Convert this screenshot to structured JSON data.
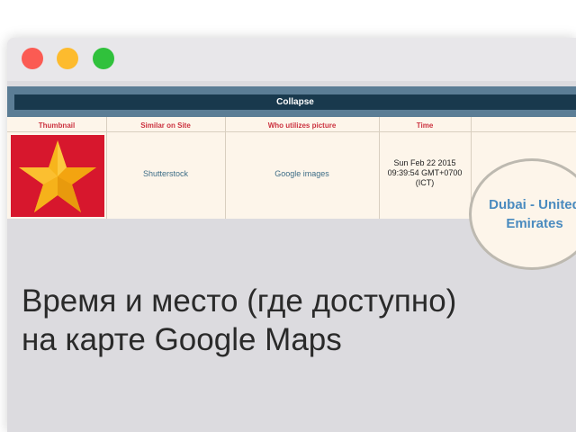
{
  "table": {
    "collapse_label": "Collapse",
    "headers": [
      "Thumbnail",
      "Similar on Site",
      "Who utilizes picture",
      "Time"
    ],
    "row": {
      "similar": "Shutterstock",
      "who": "Google images",
      "time_line1": "Sun Feb 22 2015",
      "time_line2": "09:39:54 GMT+0700",
      "time_line3": "(ICT)"
    }
  },
  "magnifier": {
    "line1": "Dubai - United",
    "line2": "Emirates"
  },
  "caption": {
    "line1": "Время и место (где доступно)",
    "line2": "на карте Google Maps"
  },
  "colors": {
    "header_bar": "#5b7d95",
    "collapse_bar": "#19394d",
    "header_text": "#cc3340",
    "link_text": "#3e6d87",
    "thumb_bg": "#d7172d",
    "star": "#f7b51c"
  },
  "icons": {
    "thumbnail": "star-icon"
  }
}
